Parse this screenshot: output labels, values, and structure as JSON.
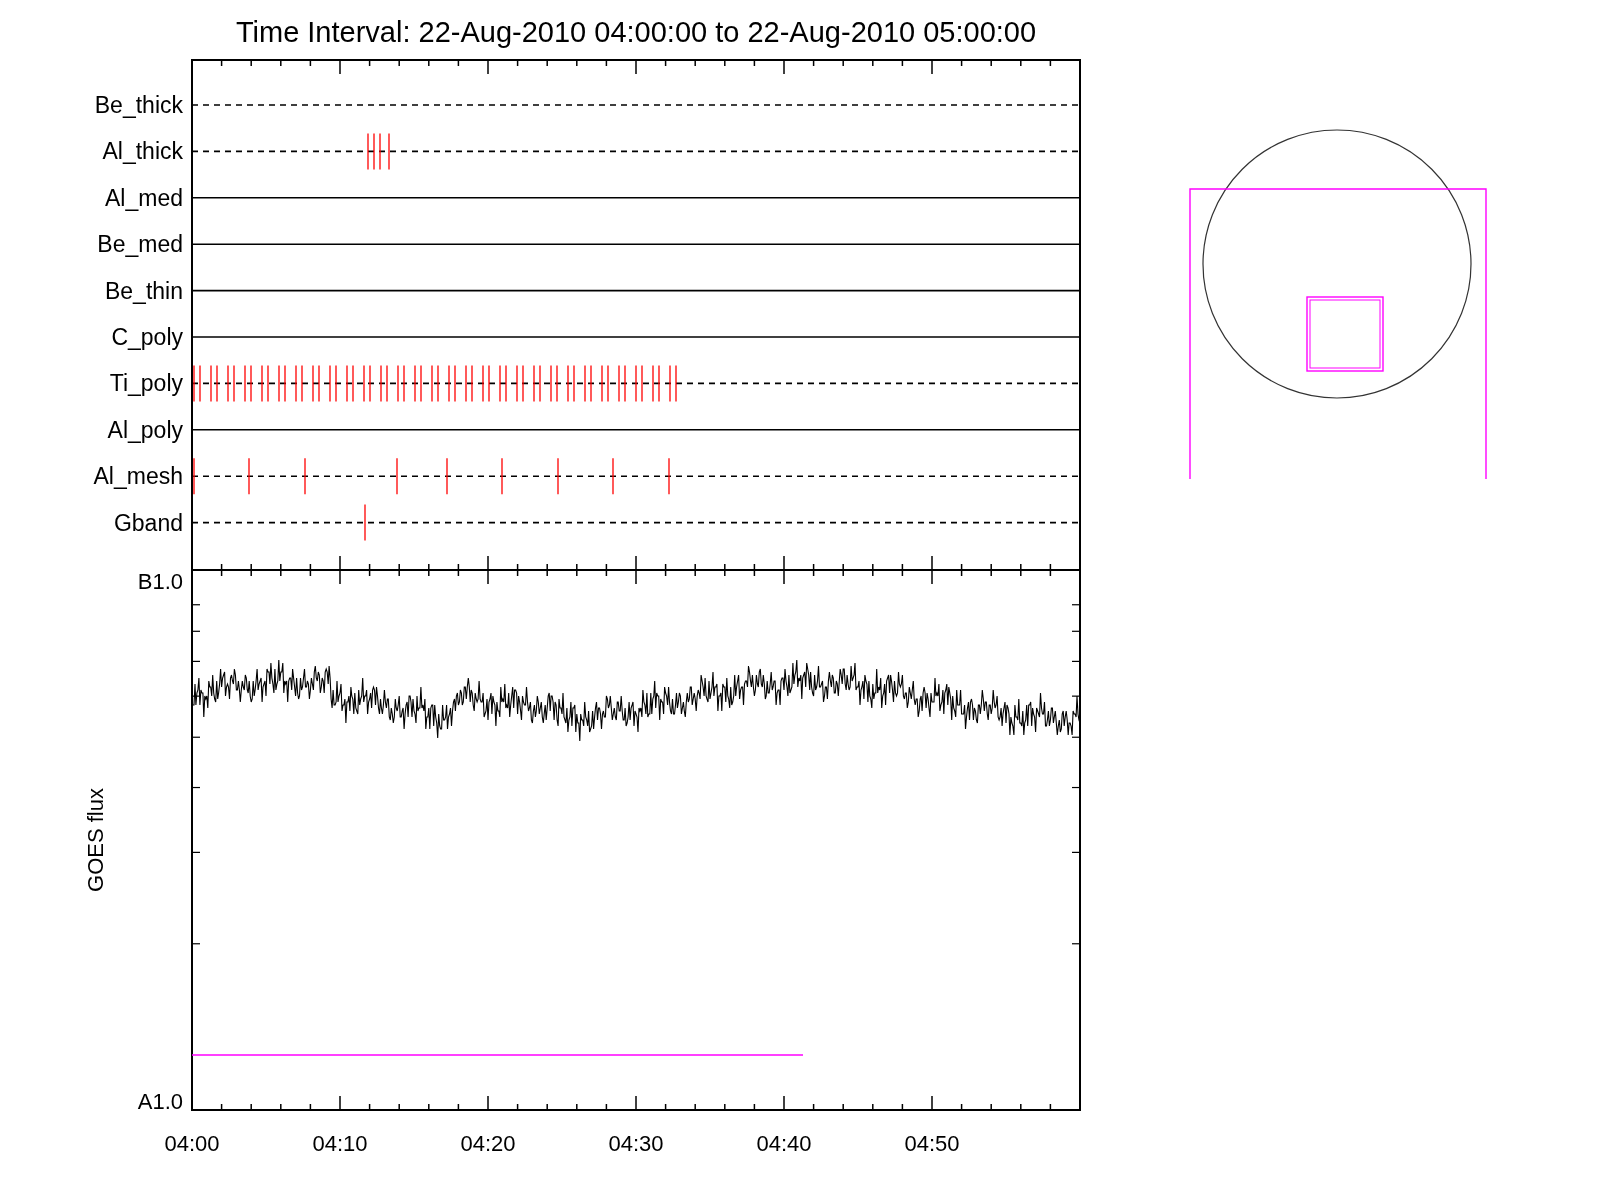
{
  "title": "Time Interval: 22-Aug-2010 04:00:00 to 22-Aug-2010 05:00:00",
  "filters": [
    {
      "label": "Be_thick",
      "kind": "dashed"
    },
    {
      "label": "Al_thick",
      "kind": "dashed"
    },
    {
      "label": "Al_med",
      "kind": "solid"
    },
    {
      "label": "Be_med",
      "kind": "solid"
    },
    {
      "label": "Be_thin",
      "kind": "solid"
    },
    {
      "label": "C_poly",
      "kind": "solid"
    },
    {
      "label": "Ti_poly",
      "kind": "dashed"
    },
    {
      "label": "Al_poly",
      "kind": "solid"
    },
    {
      "label": "Al_mesh",
      "kind": "dashed"
    },
    {
      "label": "Gband",
      "kind": "dashed"
    }
  ],
  "flux_panel": {
    "ylabel": "GOES flux",
    "y_tick_labels": [
      "B1.0",
      "A1.0"
    ],
    "time_labels": [
      "04:00",
      "04:10",
      "04:20",
      "04:30",
      "04:40",
      "04:50"
    ]
  }
}
